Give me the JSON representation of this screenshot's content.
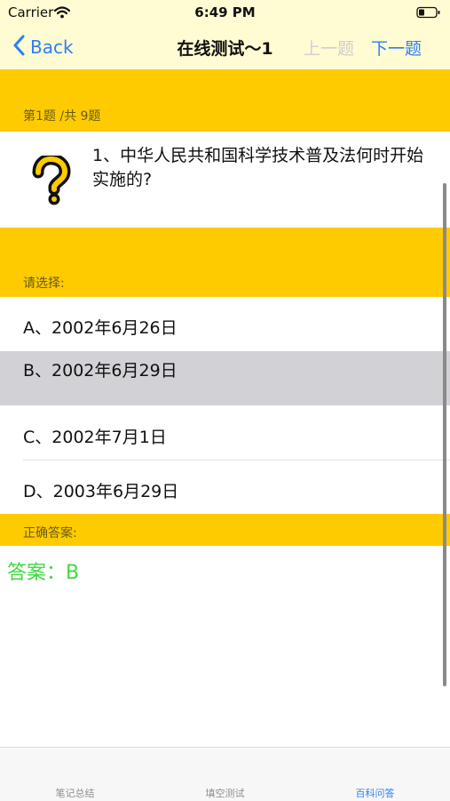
{
  "status": {
    "carrier": "Carrier",
    "time": "6:49 PM"
  },
  "nav": {
    "back_label": "Back",
    "title": "在线测试～1",
    "prev_label": "上一题",
    "next_label": "下一题"
  },
  "progress_label": "第1题 /共 9题",
  "question": {
    "text": "1、中华人民共和国科学技术普及法何时开始实施的?",
    "icon": "question-mark-icon"
  },
  "choose_label": "请选择:",
  "options": [
    {
      "label": "A、2002年6月26日",
      "selected": false
    },
    {
      "label": "B、2002年6月29日",
      "selected": true
    },
    {
      "label": "C、2002年7月1日",
      "selected": false
    },
    {
      "label": "D、2003年6月29日",
      "selected": false
    }
  ],
  "answer_section_label": "正确答案:",
  "answer_text": "答案：B",
  "tabs": [
    {
      "label": "笔记总结",
      "active": false
    },
    {
      "label": "填空测试",
      "active": false
    },
    {
      "label": "百科问答",
      "active": true
    }
  ],
  "colors": {
    "accent": "#2b7ff6",
    "section": "#fecb00",
    "answer": "#3fda3f",
    "selected_row": "#d1d1d6"
  }
}
